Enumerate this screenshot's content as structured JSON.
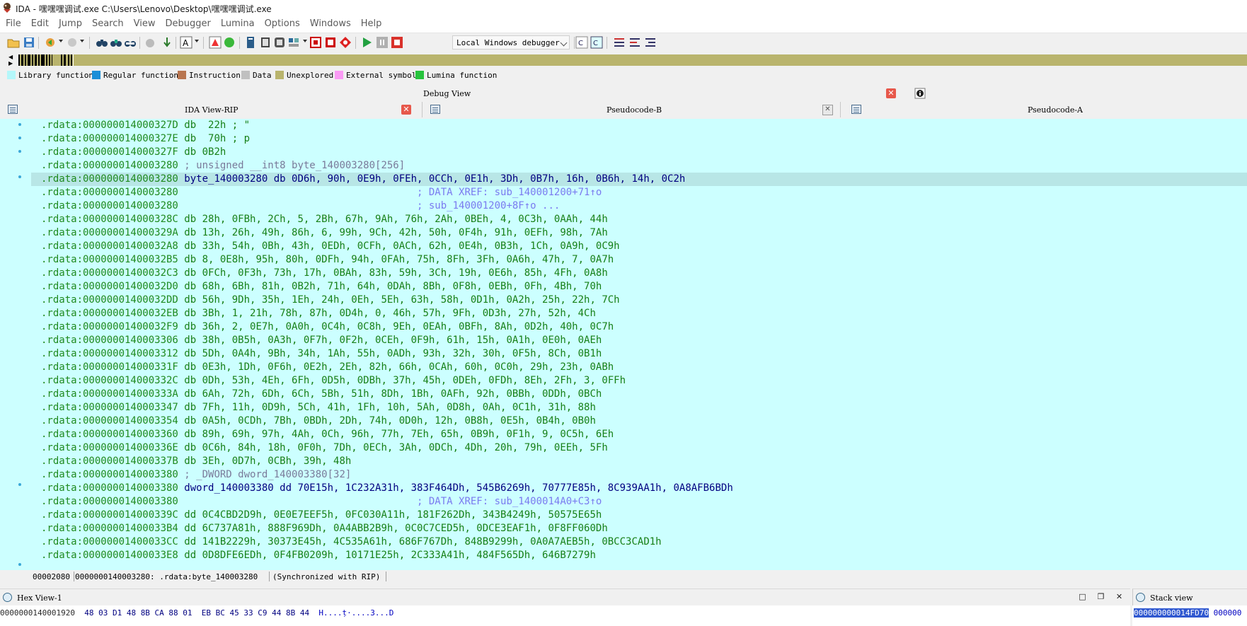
{
  "window": {
    "title": "IDA - 嘿嘿嘿调试.exe C:\\Users\\Lenovo\\Desktop\\嘿嘿嘿调试.exe"
  },
  "menu": [
    "File",
    "Edit",
    "Jump",
    "Search",
    "View",
    "Debugger",
    "Lumina",
    "Options",
    "Windows",
    "Help"
  ],
  "toolbar": {
    "debugger_select": "Local Windows debugger"
  },
  "legend": [
    {
      "label": "Library function",
      "color": "#b4f7fa"
    },
    {
      "label": "Regular function",
      "color": "#1a8fd8"
    },
    {
      "label": "Instruction",
      "color": "#b87550"
    },
    {
      "label": "Data",
      "color": "#c0c0c0"
    },
    {
      "label": "Unexplored",
      "color": "#b9b46d"
    },
    {
      "label": "External symbol",
      "color": "#fa9bf5"
    },
    {
      "label": "Lumina function",
      "color": "#27c33d"
    }
  ],
  "debug_view": {
    "label": "Debug View"
  },
  "tabs": [
    {
      "label": "IDA View-RIP"
    },
    {
      "label": "Pseudocode-B"
    },
    {
      "label": "Pseudocode-A"
    }
  ],
  "code_lines": [
    {
      "addr": ".rdata:000000014000327D",
      "body": " db  22h ; \""
    },
    {
      "addr": ".rdata:000000014000327E",
      "body": " db  70h ; p"
    },
    {
      "addr": ".rdata:000000014000327F",
      "body": " db 0B2h"
    },
    {
      "addr": ".rdata:0000000140003280",
      "body": " ; unsigned __int8 byte_140003280[256]"
    },
    {
      "addr": ".rdata:0000000140003280",
      "body": " byte_140003280 db 0D6h, 90h, 0E9h, 0FEh, 0CCh, 0E1h, 3Dh, 0B7h, 16h, 0B6h, 14h, 0C2h"
    },
    {
      "addr": ".rdata:0000000140003280",
      "body": "                                        ; DATA XREF: sub_140001200+71↑o"
    },
    {
      "addr": ".rdata:0000000140003280",
      "body": "                                        ; sub_140001200+8F↑o ..."
    },
    {
      "addr": ".rdata:000000014000328C",
      "body": " db 28h, 0FBh, 2Ch, 5, 2Bh, 67h, 9Ah, 76h, 2Ah, 0BEh, 4, 0C3h, 0AAh, 44h"
    },
    {
      "addr": ".rdata:000000014000329A",
      "body": " db 13h, 26h, 49h, 86h, 6, 99h, 9Ch, 42h, 50h, 0F4h, 91h, 0EFh, 98h, 7Ah"
    },
    {
      "addr": ".rdata:00000001400032A8",
      "body": " db 33h, 54h, 0Bh, 43h, 0EDh, 0CFh, 0ACh, 62h, 0E4h, 0B3h, 1Ch, 0A9h, 0C9h"
    },
    {
      "addr": ".rdata:00000001400032B5",
      "body": " db 8, 0E8h, 95h, 80h, 0DFh, 94h, 0FAh, 75h, 8Fh, 3Fh, 0A6h, 47h, 7, 0A7h"
    },
    {
      "addr": ".rdata:00000001400032C3",
      "body": " db 0FCh, 0F3h, 73h, 17h, 0BAh, 83h, 59h, 3Ch, 19h, 0E6h, 85h, 4Fh, 0A8h"
    },
    {
      "addr": ".rdata:00000001400032D0",
      "body": " db 68h, 6Bh, 81h, 0B2h, 71h, 64h, 0DAh, 8Bh, 0F8h, 0EBh, 0Fh, 4Bh, 70h"
    },
    {
      "addr": ".rdata:00000001400032DD",
      "body": " db 56h, 9Dh, 35h, 1Eh, 24h, 0Eh, 5Eh, 63h, 58h, 0D1h, 0A2h, 25h, 22h, 7Ch"
    },
    {
      "addr": ".rdata:00000001400032EB",
      "body": " db 3Bh, 1, 21h, 78h, 87h, 0D4h, 0, 46h, 57h, 9Fh, 0D3h, 27h, 52h, 4Ch"
    },
    {
      "addr": ".rdata:00000001400032F9",
      "body": " db 36h, 2, 0E7h, 0A0h, 0C4h, 0C8h, 9Eh, 0EAh, 0BFh, 8Ah, 0D2h, 40h, 0C7h"
    },
    {
      "addr": ".rdata:0000000140003306",
      "body": " db 38h, 0B5h, 0A3h, 0F7h, 0F2h, 0CEh, 0F9h, 61h, 15h, 0A1h, 0E0h, 0AEh"
    },
    {
      "addr": ".rdata:0000000140003312",
      "body": " db 5Dh, 0A4h, 9Bh, 34h, 1Ah, 55h, 0ADh, 93h, 32h, 30h, 0F5h, 8Ch, 0B1h"
    },
    {
      "addr": ".rdata:000000014000331F",
      "body": " db 0E3h, 1Dh, 0F6h, 0E2h, 2Eh, 82h, 66h, 0CAh, 60h, 0C0h, 29h, 23h, 0ABh"
    },
    {
      "addr": ".rdata:000000014000332C",
      "body": " db 0Dh, 53h, 4Eh, 6Fh, 0D5h, 0DBh, 37h, 45h, 0DEh, 0FDh, 8Eh, 2Fh, 3, 0FFh"
    },
    {
      "addr": ".rdata:000000014000333A",
      "body": " db 6Ah, 72h, 6Dh, 6Ch, 5Bh, 51h, 8Dh, 1Bh, 0AFh, 92h, 0BBh, 0DDh, 0BCh"
    },
    {
      "addr": ".rdata:0000000140003347",
      "body": " db 7Fh, 11h, 0D9h, 5Ch, 41h, 1Fh, 10h, 5Ah, 0D8h, 0Ah, 0C1h, 31h, 88h"
    },
    {
      "addr": ".rdata:0000000140003354",
      "body": " db 0A5h, 0CDh, 7Bh, 0BDh, 2Dh, 74h, 0D0h, 12h, 0B8h, 0E5h, 0B4h, 0B0h"
    },
    {
      "addr": ".rdata:0000000140003360",
      "body": " db 89h, 69h, 97h, 4Ah, 0Ch, 96h, 77h, 7Eh, 65h, 0B9h, 0F1h, 9, 0C5h, 6Eh"
    },
    {
      "addr": ".rdata:000000014000336E",
      "body": " db 0C6h, 84h, 18h, 0F0h, 7Dh, 0ECh, 3Ah, 0DCh, 4Dh, 20h, 79h, 0EEh, 5Fh"
    },
    {
      "addr": ".rdata:000000014000337B",
      "body": " db 3Eh, 0D7h, 0CBh, 39h, 48h"
    },
    {
      "addr": ".rdata:0000000140003380",
      "body": " ; _DWORD dword_140003380[32]"
    },
    {
      "addr": ".rdata:0000000140003380",
      "body": " dword_140003380 dd 70E15h, 1C232A31h, 383F464Dh, 545B6269h, 70777E85h, 8C939AA1h, 0A8AFB6BDh"
    },
    {
      "addr": ".rdata:0000000140003380",
      "body": "                                        ; DATA XREF: sub_1400014A0+C3↑o"
    },
    {
      "addr": ".rdata:000000014000339C",
      "body": " dd 0C4CBD2D9h, 0E0E7EEF5h, 0FC030A11h, 181F262Dh, 343B4249h, 50575E65h"
    },
    {
      "addr": ".rdata:00000001400033B4",
      "body": " dd 6C737A81h, 888F969Dh, 0A4ABB2B9h, 0C0C7CED5h, 0DCE3EAF1h, 0F8FF060Dh"
    },
    {
      "addr": ".rdata:00000001400033CC",
      "body": " dd 141B2229h, 30373E45h, 4C535A61h, 686F767Dh, 848B9299h, 0A0A7AEB5h, 0BCC3CAD1h"
    },
    {
      "addr": ".rdata:00000001400033E8",
      "body": " dd 0D8DFE6EDh, 0F4FB0209h, 10171E25h, 2C333A41h, 484F565Dh, 646B7279h"
    }
  ],
  "status": {
    "offset": "00002080",
    "location": "0000000140003280: .rdata:byte_140003280",
    "sync": "(Synchronized with RIP)"
  },
  "hex_view": {
    "title": "Hex View-1",
    "rows": [
      {
        "addr": "0000000140001920",
        "bytes": "48 03 D1 48 8B CA 88 01  EB BC 45 33 C9 44 8B 44",
        "ascii": "H....ṭ·....3...D"
      }
    ]
  },
  "stack_view": {
    "title": "Stack view",
    "rows": [
      {
        "addr": "000000000014FD70",
        "value": "000000"
      }
    ]
  }
}
